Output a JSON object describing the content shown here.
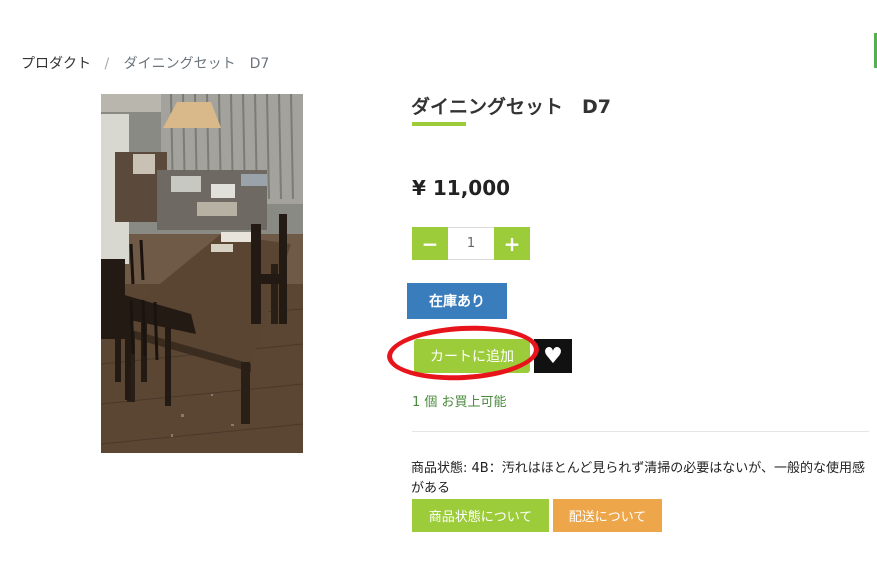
{
  "breadcrumb": {
    "root": "プロダクト",
    "separator": "/",
    "current": "ダイニングセット　D7"
  },
  "product": {
    "image_alt": "dining-set-photo",
    "title": "ダイニングセット　D7",
    "price": "¥ 11,000",
    "quantity": {
      "minus_icon": "−",
      "plus_icon": "+",
      "value": "1"
    },
    "stock_label": "在庫あり",
    "add_to_cart_label": "カートに追加",
    "wishlist_icon": "♥",
    "availability": "1 個 お買上可能",
    "condition_text": "商品状態: 4B：汚れはほとんど見られず清掃の必要はないが、一般的な使用感がある",
    "buttons": {
      "condition": "商品状態について",
      "shipping": "配送について"
    }
  },
  "colors": {
    "accent_green": "#9ccc3a",
    "stock_blue": "#3a7dbd",
    "shipping_orange": "#eea64a",
    "annotation_red": "#e8141c",
    "text_green": "#4a8a3c"
  }
}
